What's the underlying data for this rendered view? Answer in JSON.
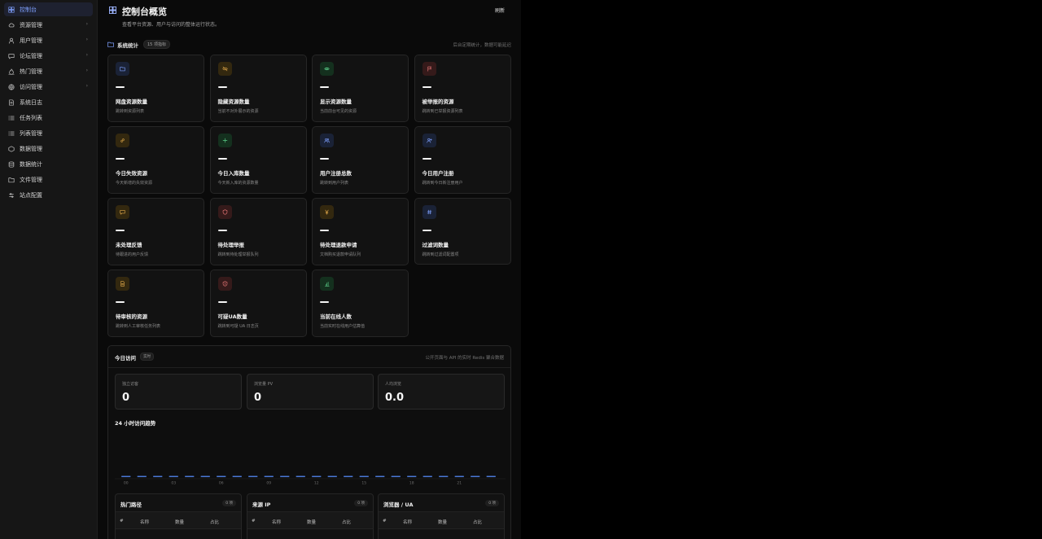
{
  "sidebar": {
    "items": [
      {
        "label": "控制台",
        "icon": "grid-icon",
        "active": true,
        "chevron": false
      },
      {
        "label": "资源管理",
        "icon": "cloud-icon",
        "chevron": true
      },
      {
        "label": "用户管理",
        "icon": "user-icon",
        "chevron": true
      },
      {
        "label": "论坛管理",
        "icon": "chat-icon",
        "chevron": true
      },
      {
        "label": "热门管理",
        "icon": "flame-icon",
        "chevron": true
      },
      {
        "label": "访问管理",
        "icon": "globe-icon",
        "chevron": true
      },
      {
        "label": "系统日志",
        "icon": "doc-icon",
        "chevron": false
      },
      {
        "label": "任务列表",
        "icon": "list-icon",
        "chevron": false
      },
      {
        "label": "列表管理",
        "icon": "list-icon",
        "chevron": false
      },
      {
        "label": "数据管理",
        "icon": "box-icon",
        "chevron": false
      },
      {
        "label": "数据统计",
        "icon": "database-icon",
        "chevron": false
      },
      {
        "label": "文件管理",
        "icon": "folder-icon",
        "chevron": false
      },
      {
        "label": "站点配置",
        "icon": "settings-icon",
        "chevron": false
      }
    ]
  },
  "header": {
    "title": "控制台概览",
    "subtitle": "查看平台资源、用户与访问的整体运行状态。",
    "refresh_label": "刷新"
  },
  "stats_section": {
    "title": "系统统计",
    "badge": "15 项指标",
    "note": "后台定期统计，数据可能延迟"
  },
  "cards": [
    {
      "title": "网盘资源数量",
      "desc": "跳转到资源列表",
      "icon": "folder-icon",
      "bg": "#1a2236",
      "fg": "#7fa1ff"
    },
    {
      "title": "隐藏资源数量",
      "desc": "当前不对外展示的资源",
      "icon": "eye-off-icon",
      "bg": "#33280f",
      "fg": "#e0a84a"
    },
    {
      "title": "显示资源数量",
      "desc": "当前前台可见的资源",
      "icon": "eye-icon",
      "bg": "#14301e",
      "fg": "#5ccf8a"
    },
    {
      "title": "被举报的资源",
      "desc": "跳转到已举报资源列表",
      "icon": "flag-icon",
      "bg": "#351a1a",
      "fg": "#f07a7a"
    },
    {
      "title": "今日失效资源",
      "desc": "今天新增的失效资源",
      "icon": "link-icon",
      "bg": "#33280f",
      "fg": "#e0a84a"
    },
    {
      "title": "今日入库数量",
      "desc": "今天新入库的资源数量",
      "icon": "plus-icon",
      "bg": "#14301e",
      "fg": "#5ccf8a"
    },
    {
      "title": "用户注册总数",
      "desc": "跳转到用户列表",
      "icon": "users-icon",
      "bg": "#1a2236",
      "fg": "#7fa1ff"
    },
    {
      "title": "今日用户注册",
      "desc": "跳转到今日新注册用户",
      "icon": "user-plus-icon",
      "bg": "#1a2236",
      "fg": "#7fa1ff"
    },
    {
      "title": "未处理反馈",
      "desc": "待跟进的用户反馈",
      "icon": "message-icon",
      "bg": "#33280f",
      "fg": "#e0a84a"
    },
    {
      "title": "待处理举报",
      "desc": "跳转到待处理举报队列",
      "icon": "shield-icon",
      "bg": "#351a1a",
      "fg": "#f07a7a"
    },
    {
      "title": "待处理退款申请",
      "desc": "文档购买退款申请队列",
      "icon": "yen-icon",
      "bg": "#33280f",
      "fg": "#e0a84a"
    },
    {
      "title": "过滤词数量",
      "desc": "跳转到过滤词配置项",
      "icon": "hash-icon",
      "bg": "#1a2236",
      "fg": "#7fa1ff"
    },
    {
      "title": "待审核的资源",
      "desc": "跳转到人工审核任务列表",
      "icon": "file-icon",
      "bg": "#33280f",
      "fg": "#e0a84a"
    },
    {
      "title": "可疑UA数量",
      "desc": "跳转到可疑 UA 日志页",
      "icon": "shield-alert-icon",
      "bg": "#351a1a",
      "fg": "#f07a7a"
    },
    {
      "title": "当前在线人数",
      "desc": "当前实时在线用户估算值",
      "icon": "bar-chart-icon",
      "bg": "#14301e",
      "fg": "#5ccf8a"
    }
  ],
  "today": {
    "title": "今日访问",
    "live_badge": "实时",
    "note": "公开页面与 API 的实时 Redis 聚合数据",
    "metrics": [
      {
        "label": "独立访客",
        "value": "0"
      },
      {
        "label": "浏览量 PV",
        "value": "0"
      },
      {
        "label": "人均浏览",
        "value": "0.0"
      }
    ],
    "trend_title": "24 小时访问趋势"
  },
  "chart_data": {
    "type": "bar",
    "x": [
      0,
      1,
      2,
      3,
      4,
      5,
      6,
      7,
      8,
      9,
      10,
      11,
      12,
      13,
      14,
      15,
      16,
      17,
      18,
      19,
      20,
      21,
      22,
      23
    ],
    "values": [
      0,
      0,
      0,
      0,
      0,
      0,
      0,
      0,
      0,
      0,
      0,
      0,
      0,
      0,
      0,
      0,
      0,
      0,
      0,
      0,
      0,
      0,
      0,
      0
    ],
    "tick_labels": [
      "00",
      "03",
      "06",
      "09",
      "12",
      "15",
      "18",
      "21"
    ],
    "bar_color": "#4a78d6"
  },
  "tables": [
    {
      "title": "热门路径",
      "count": "0 项",
      "columns": [
        "#",
        "名称",
        "数量",
        "占比"
      ]
    },
    {
      "title": "来源 IP",
      "count": "0 项",
      "columns": [
        "#",
        "名称",
        "数量",
        "占比"
      ]
    },
    {
      "title": "浏览器 / UA",
      "count": "0 项",
      "columns": [
        "#",
        "名称",
        "数量",
        "占比"
      ]
    }
  ]
}
